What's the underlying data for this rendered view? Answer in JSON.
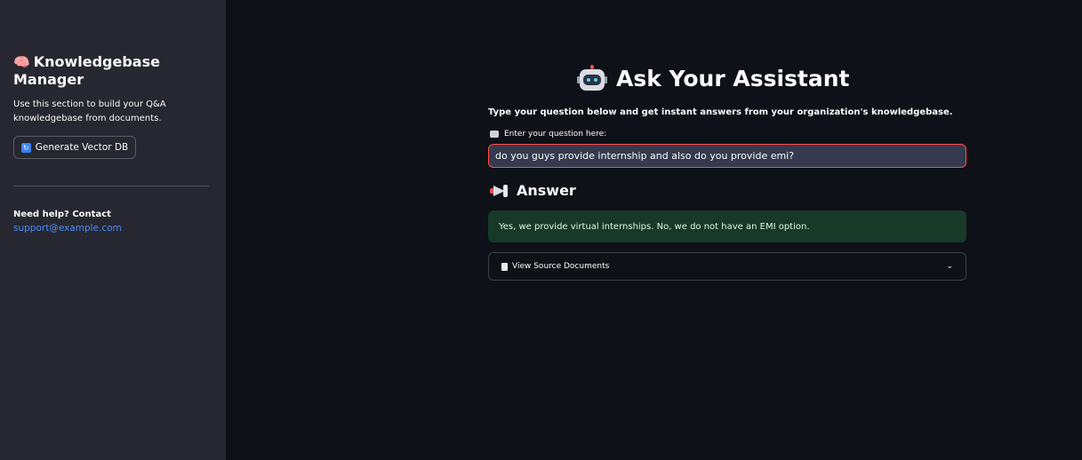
{
  "sidebar": {
    "title_emoji": "🧠",
    "title": "Knowledgebase Manager",
    "description": "Use this section to build your Q&A knowledgebase from documents.",
    "generate_button": {
      "icon": "refresh-icon",
      "label": "Generate Vector DB"
    },
    "help_text": "Need help? Contact",
    "help_link": "support@example.com"
  },
  "main": {
    "title_icon": "robot-icon",
    "title": "Ask Your Assistant",
    "intro": "Type your question below and get instant answers from your organization's knowledgebase.",
    "question_label": "Enter your question here:",
    "question_value": "do you guys provide internship and also do you provide emi?",
    "answer_heading": "Answer",
    "answer_text": "Yes, we provide virtual internships. No, we do not have an EMI option.",
    "sources_label": "View Source Documents"
  },
  "colors": {
    "background": "#0e1117",
    "sidebar": "#262730",
    "input_focus_border": "#ff4b4b",
    "answer_bg": "#173928",
    "link": "#4a8cff"
  }
}
